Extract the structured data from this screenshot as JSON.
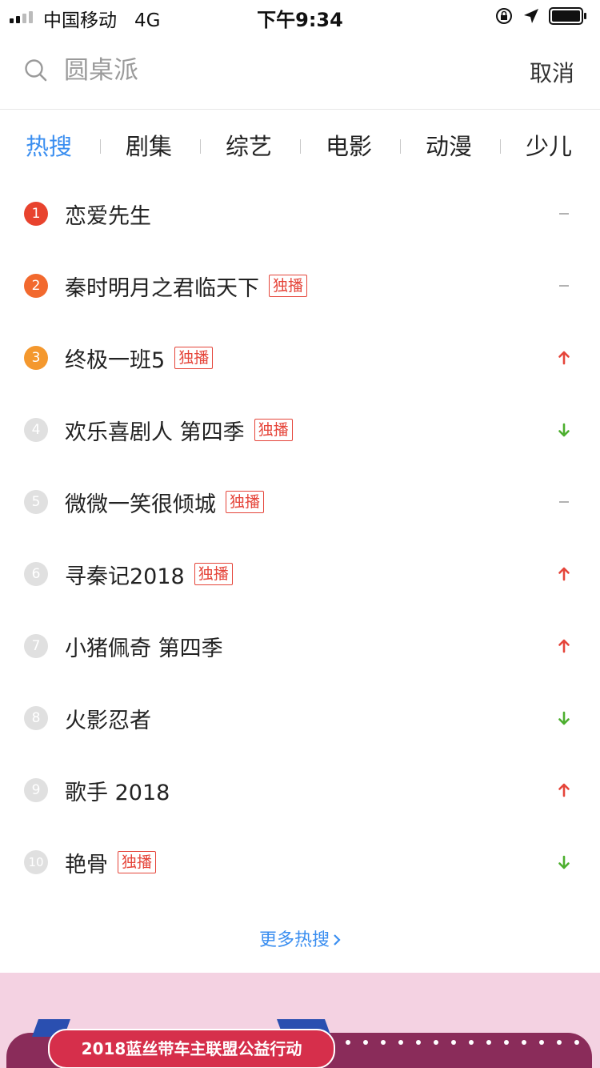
{
  "status_bar": {
    "carrier": "中国移动",
    "network": "4G",
    "time": "下午9:34"
  },
  "search": {
    "placeholder": "圆桌派",
    "cancel_label": "取消"
  },
  "tabs": [
    {
      "label": "热搜",
      "active": true
    },
    {
      "label": "剧集",
      "active": false
    },
    {
      "label": "综艺",
      "active": false
    },
    {
      "label": "电影",
      "active": false
    },
    {
      "label": "动漫",
      "active": false
    },
    {
      "label": "少儿",
      "active": false
    }
  ],
  "rank_list": [
    {
      "rank": "1",
      "title": "恋爱先生",
      "tag": "",
      "trend": "flat"
    },
    {
      "rank": "2",
      "title": "秦时明月之君临天下",
      "tag": "独播",
      "trend": "flat"
    },
    {
      "rank": "3",
      "title": "终极一班5",
      "tag": "独播",
      "trend": "up"
    },
    {
      "rank": "4",
      "title": "欢乐喜剧人 第四季",
      "tag": "独播",
      "trend": "down"
    },
    {
      "rank": "5",
      "title": "微微一笑很倾城",
      "tag": "独播",
      "trend": "flat"
    },
    {
      "rank": "6",
      "title": "寻秦记2018",
      "tag": "独播",
      "trend": "up"
    },
    {
      "rank": "7",
      "title": "小猪佩奇 第四季",
      "tag": "",
      "trend": "up"
    },
    {
      "rank": "8",
      "title": "火影忍者",
      "tag": "",
      "trend": "down"
    },
    {
      "rank": "9",
      "title": "歌手 2018",
      "tag": "",
      "trend": "up"
    },
    {
      "rank": "10",
      "title": "艳骨",
      "tag": "独播",
      "trend": "down"
    }
  ],
  "more_link": "更多热搜",
  "banner": {
    "title": "2018蓝丝带车主联盟公益行动"
  },
  "colors": {
    "accent": "#3a8ef0",
    "up": "#e5453a",
    "down": "#4caf2e",
    "flat": "#aaaaaa",
    "tag": "#e5453a"
  }
}
